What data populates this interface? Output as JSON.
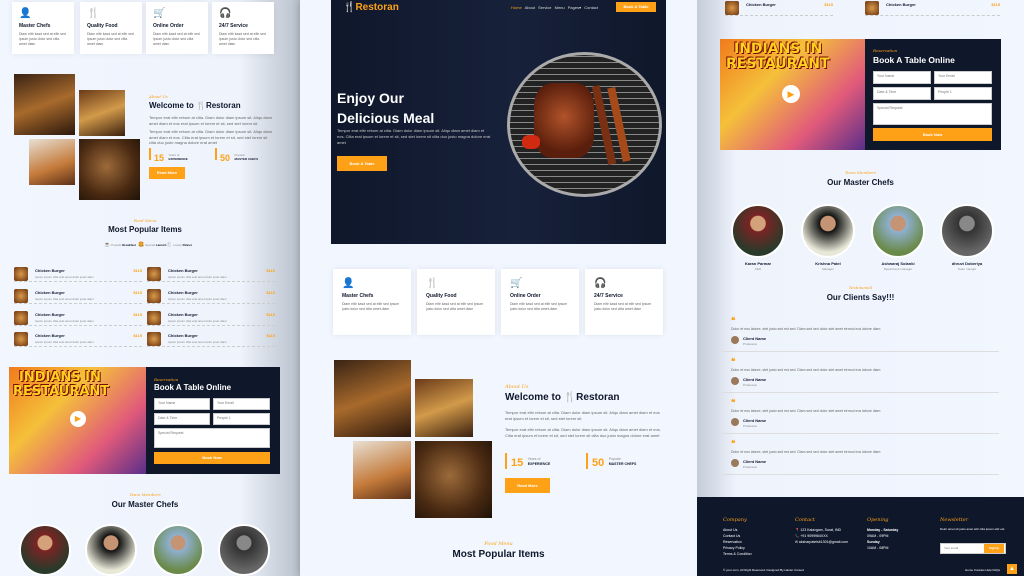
{
  "services": [
    {
      "icon": "chef-icon",
      "glyph": "👤",
      "title": "Master Chefs",
      "desc": "Diam elitr kasd sed at elitr sed ipsum justo dolor sed clita amet diam"
    },
    {
      "icon": "utensils-icon",
      "glyph": "🍴",
      "title": "Quality Food",
      "desc": "Diam elitr kasd sed at elitr sed ipsum justo dolor sed clita amet diam"
    },
    {
      "icon": "cart-icon",
      "glyph": "🛒",
      "title": "Online Order",
      "desc": "Diam elitr kasd sed at elitr sed ipsum justo dolor sed clita amet diam"
    },
    {
      "icon": "headset-icon",
      "glyph": "🎧",
      "title": "24/7 Service",
      "desc": "Diam elitr kasd sed at elitr sed ipsum justo dolor sed clita amet diam"
    }
  ],
  "about": {
    "sub": "About Us",
    "title_prefix": "Welcome to ",
    "brand": "Restoran",
    "p1": "Tempor erat elitr rebum at clita. Diam dolor diam ipsum sit. Aliqu diam amet diam et eos erat ipsum et lorem et sit, sed stet lorem sit.",
    "p2": "Tempor erat elitr rebum at clita. Diam dolor diam ipsum sit. Aliqu diam amet diam et eos. Clita erat ipsum et lorem et sit, sed stet lorem sit clita duo justo magna dolore erat amet",
    "stat1_num": "15",
    "stat1_a": "Years of",
    "stat1_b": "EXPERIENCE",
    "stat2_num": "50",
    "stat2_a": "Popular",
    "stat2_b": "MASTER CHEFS",
    "button": "Read More"
  },
  "menu": {
    "sub": "Food Menu",
    "title": "Most Popular Items",
    "tabs": [
      {
        "a": "Popular",
        "b": "Breakfast"
      },
      {
        "a": "Special",
        "b": "Launch"
      },
      {
        "a": "Lovely",
        "b": "Dinner"
      }
    ],
    "item_name": "Chicken Burger",
    "item_price": "$115",
    "item_desc": "Ipsum ipsum clita erat amet dolor justo diam"
  },
  "reservation": {
    "banner_line1": "INDIANS IN",
    "banner_line2": "RESTAURANT",
    "sub": "Reservation",
    "title": "Book A Table Online",
    "name_ph": "Your Name",
    "email_ph": "Your Email",
    "date_ph": "Date & Time",
    "people_value": "People 1",
    "request_ph": "Special Request",
    "button": "Book Now"
  },
  "team": {
    "sub": "Team Members",
    "title": "Our Master Chefs",
    "chefs": [
      {
        "name": "Karan Parmar",
        "role": "CEO"
      },
      {
        "name": "Krishna Patel",
        "role": "Manager"
      },
      {
        "name": "Ashwaraj Solanki",
        "role": "Department manager"
      },
      {
        "name": "dhruvi Doberiya",
        "role": "Team manger"
      }
    ]
  },
  "nav": {
    "brand": "Restoran",
    "links": [
      "Home",
      "About",
      "Service",
      "Menu",
      "Pages▾",
      "Contact"
    ],
    "cta": "Book A Table"
  },
  "hero": {
    "line1": "Enjoy Our",
    "line2": "Delicious Meal",
    "text": "Tempor erat elitr rebum at clita. Diam dolor diam ipsum sit. Aliqu diam amet diam et eos. Clita erat ipsum et lorem et sit, sed stet lorem sit clita duo justo magna dolore erat amet",
    "button": "Book A Table"
  },
  "testimonial": {
    "sub": "Testimonial",
    "title": "Our Clients Say!!!",
    "text": "Dolor et eos labore, stet justo sed est sed. Diam sed sed dolor stet amet eirmod eos labore diam",
    "name": "Client Name",
    "role": "Profession"
  },
  "footer": {
    "company": "Company",
    "company_links": [
      "About Us",
      "Contact Us",
      "Reservation",
      "Privacy Policy",
      "Terms & Condition"
    ],
    "contact": "Contact",
    "contact_lines": [
      "123 Kalavgam, Surat, IND",
      "+91 9099964XXX",
      "aksharpatelsb1301@gmail.com"
    ],
    "opening": "Opening",
    "opening_lines": [
      "Monday - Saturday",
      "09AM - 09PM",
      "Sunday",
      "10AM - 08PM"
    ],
    "newsletter": "Newsletter",
    "news_text": "Dolor amet sit justo amet elitr clita ipsum elitr est.",
    "email_ph": "Your email",
    "signup": "SignUp",
    "copyright": "© your-com, All Right Reserved. Designed By Haxter Cursed",
    "bottom_links": "Home Cookies Help FAQs"
  }
}
